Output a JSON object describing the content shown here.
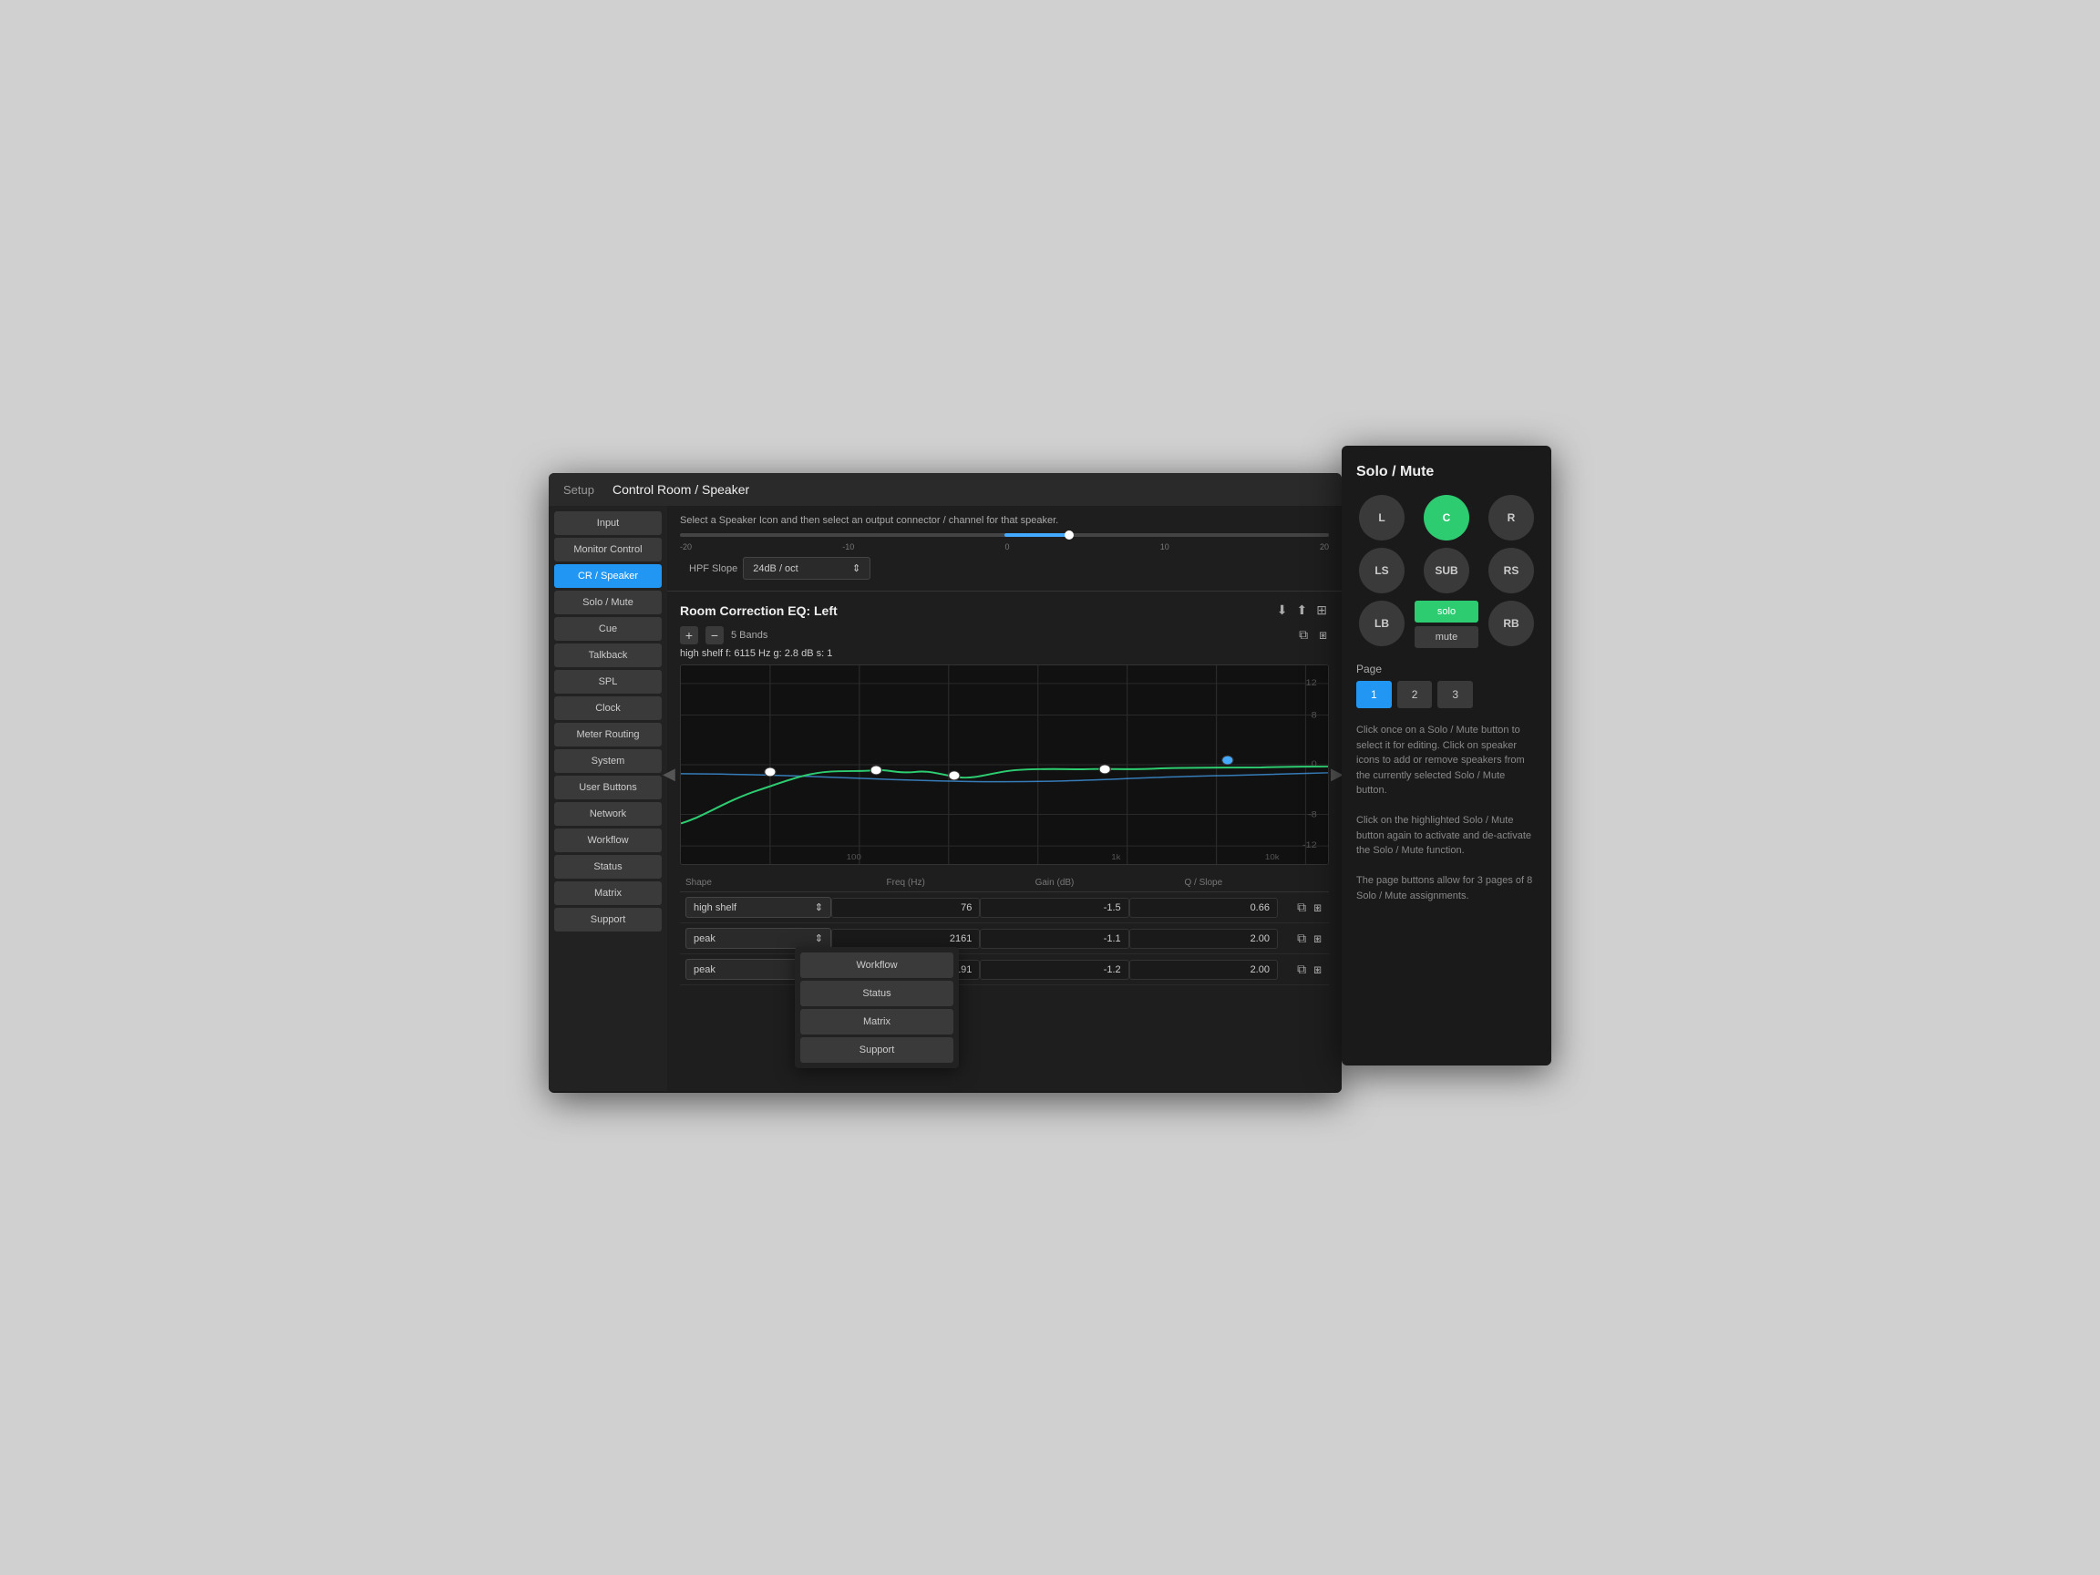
{
  "app": {
    "title": "Setup",
    "page_title": "Control Room / Speaker"
  },
  "sidebar": {
    "items": [
      {
        "label": "Input",
        "active": false
      },
      {
        "label": "Monitor Control",
        "active": false
      },
      {
        "label": "CR / Speaker",
        "active": true
      },
      {
        "label": "Solo / Mute",
        "active": false
      },
      {
        "label": "Cue",
        "active": false
      },
      {
        "label": "Talkback",
        "active": false
      },
      {
        "label": "SPL",
        "active": false
      },
      {
        "label": "Clock",
        "active": false
      },
      {
        "label": "Meter Routing",
        "active": false
      },
      {
        "label": "System",
        "active": false
      },
      {
        "label": "User Buttons",
        "active": false
      },
      {
        "label": "Network",
        "active": false
      },
      {
        "label": "Workflow",
        "active": false
      },
      {
        "label": "Status",
        "active": false
      },
      {
        "label": "Matrix",
        "active": false
      },
      {
        "label": "Support",
        "active": false
      }
    ]
  },
  "panel": {
    "hint": "Select a Speaker Icon and then select an output connector / channel for that speaker.",
    "hpf_slope_label": "HPF Slope",
    "hpf_slope_value": "24dB / oct",
    "slider_labels": [
      "-20",
      "-10",
      "0",
      "10",
      "20"
    ]
  },
  "eq": {
    "title": "Room Correction EQ: Left",
    "bands_label": "5 Bands",
    "band_info": "high shelf   f: 6115 Hz   g: 2.8 dB   s: 1",
    "columns": [
      "Shape",
      "Freq (Hz)",
      "Gain (dB)",
      "Q / Slope",
      ""
    ],
    "rows": [
      {
        "shape": "high shelf",
        "freq": "76",
        "gain": "-1.5",
        "q": "0.66"
      },
      {
        "shape": "peak",
        "freq": "2161",
        "gain": "-1.1",
        "q": "2.00"
      },
      {
        "shape": "peak",
        "freq": "191",
        "gain": "-1.2",
        "q": "2.00"
      }
    ]
  },
  "floating_menu": {
    "items": [
      "Workflow",
      "Status",
      "Matrix",
      "Support"
    ]
  },
  "solo_mute": {
    "title": "Solo / Mute",
    "speakers": [
      {
        "label": "L",
        "active": false
      },
      {
        "label": "C",
        "active": true
      },
      {
        "label": "R",
        "active": false
      },
      {
        "label": "LS",
        "active": false
      },
      {
        "label": "SUB",
        "active": false
      },
      {
        "label": "RS",
        "active": false
      },
      {
        "label": "LB",
        "active": false
      },
      {
        "label": "",
        "active": false
      },
      {
        "label": "RB",
        "active": false
      }
    ],
    "solo_label": "solo",
    "mute_label": "mute",
    "page_label": "Page",
    "pages": [
      {
        "num": "1",
        "active": true
      },
      {
        "num": "2",
        "active": false
      },
      {
        "num": "3",
        "active": false
      }
    ],
    "info": "Click once on a Solo / Mute button to select it for editing. Click on speaker icons to add or remove speakers from the currently selected Solo / Mute button.\n\nClick on the highlighted Solo / Mute button again to activate and de-activate the Solo / Mute function.\n\nThe page buttons allow for 3 pages of 8 Solo / Mute assignments."
  }
}
